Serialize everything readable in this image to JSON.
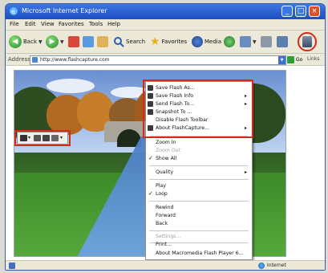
{
  "window": {
    "title": "Microsoft Internet Explorer",
    "min_label": "_",
    "max_label": "□",
    "close_label": "×"
  },
  "menubar": [
    "File",
    "Edit",
    "View",
    "Favorites",
    "Tools",
    "Help"
  ],
  "toolbar": {
    "back_label": "Back",
    "search_label": "Search",
    "favorites_label": "Favorites",
    "media_label": "Media"
  },
  "address": {
    "label": "Address",
    "url": "http://www.flashcapture.com",
    "go_label": "Go",
    "links_label": "Links"
  },
  "context_menu": {
    "items": [
      {
        "label": "Save Flash As...",
        "icon": "save-icon"
      },
      {
        "label": "Save Flash Info",
        "icon": "info-icon",
        "submenu": true
      },
      {
        "label": "Send Flash To...",
        "icon": "send-icon",
        "submenu": true
      },
      {
        "label": "Snapshot To ...",
        "icon": "camera-icon"
      },
      {
        "label": "Disable Flash Toolbar"
      },
      {
        "label": "About FlashCapture...",
        "icon": "about-icon",
        "submenu": true
      },
      {
        "label": "Zoom In"
      },
      {
        "label": "Zoom Out",
        "disabled": true
      },
      {
        "label": "Show All",
        "checked": true
      },
      {
        "label": "Quality",
        "submenu": true
      },
      {
        "label": "Play"
      },
      {
        "label": "Loop",
        "checked": true
      },
      {
        "label": "Rewind"
      },
      {
        "label": "Forward"
      },
      {
        "label": "Back"
      },
      {
        "label": "Settings...",
        "disabled": true
      },
      {
        "label": "Print..."
      },
      {
        "label": "About Macromedia Flash Player 6..."
      }
    ],
    "submenu_arrow": "▸",
    "check_mark": "✓"
  },
  "status": {
    "zone": "Internet"
  },
  "colors": {
    "highlight": "#d42a1a",
    "titlebar": "#2a5fd0"
  }
}
